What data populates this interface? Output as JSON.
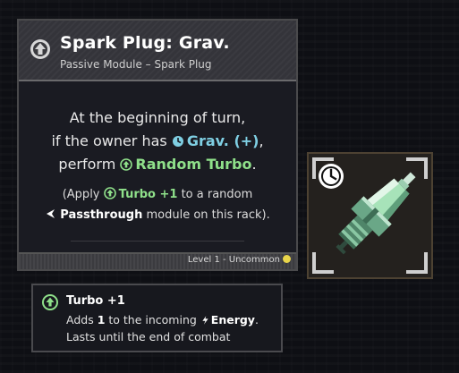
{
  "card": {
    "title": "Spark Plug: Grav.",
    "subtitle": "Passive Module – Spark Plug",
    "header_icon": "up-arrow-circle-icon",
    "description": {
      "line1": "At the beginning of turn,",
      "line2_pre": "if the owner has ",
      "line2_kw": "Grav. (+)",
      "line2_post": ",",
      "line3_pre": "perform ",
      "line3_kw": "Random Turbo",
      "line3_post": "."
    },
    "note": {
      "line1_pre": "(Apply ",
      "line1_kw": "Turbo +1",
      "line1_post": " to a random",
      "line2_kw": "Passthrough",
      "line2_post": " module on this rack)."
    },
    "rarity": "Level 1 - Uncommon",
    "colors": {
      "grav": "#7fcfe3",
      "turbo": "#8fe08a",
      "uncommon": "#e9d54a"
    }
  },
  "item": {
    "name": "spark-plug",
    "badge_icon": "clock-icon"
  },
  "tooltip": {
    "title": "Turbo +1",
    "line1_pre": "Adds ",
    "line1_num": "1",
    "line1_mid": " to the incoming ",
    "line1_kw": "Energy",
    "line1_post": ".",
    "line2": "Lasts until the end of combat"
  }
}
